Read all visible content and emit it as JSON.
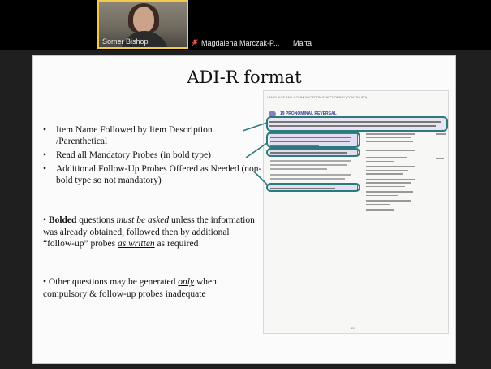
{
  "participants": {
    "active_name": "Somer Bishop",
    "second_name": "Magdalena Marczak-P...",
    "third_name": "Marta"
  },
  "slide": {
    "title": "ADI-R format",
    "bullets": [
      "Item Name Followed by Item Description /Parenthetical",
      "Read all Mandatory Probes (in bold type)",
      "Additional Follow-Up Probes Offered as Needed (non-bold type so not mandatory)"
    ],
    "para1": {
      "bullet": "•",
      "bold": "Bolded",
      "t1": " questions ",
      "u1": "must be asked",
      "t2": " unless the information was already obtained, followed then by additional “follow-up” probes ",
      "u2": "as written",
      "t3": " as required"
    },
    "para2": {
      "bullet": "•",
      "t1": " Other questions may be generated ",
      "u1": "only",
      "t2": " when compulsory & follow-up probes inadequate"
    },
    "form": {
      "header": "LANGUAGE AND COMMUNICATION FUNCTIONING (CONTINUED)",
      "item_number": "19",
      "item_title": "PRONOMINAL REVERSAL",
      "page_number": "33"
    }
  },
  "colors": {
    "active_speaker": "#f2c94c",
    "annotation": "#2c7a7b",
    "form_accent": "#6f62a8"
  }
}
